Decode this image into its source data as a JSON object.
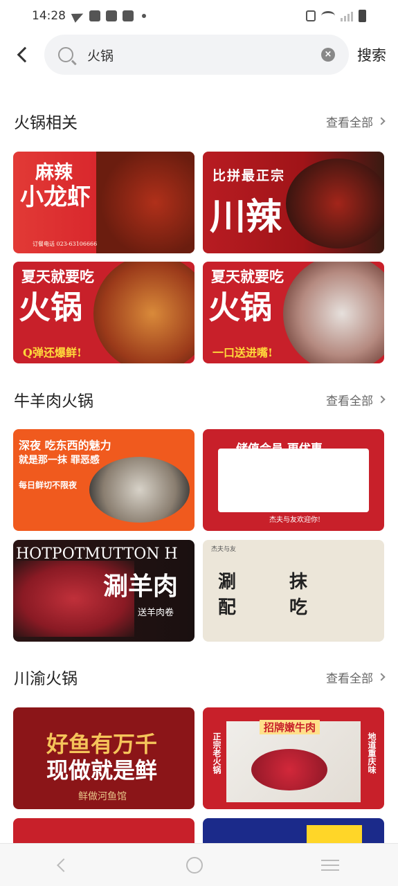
{
  "status": {
    "time": "14:28"
  },
  "search": {
    "query": "火锅",
    "button": "搜索"
  },
  "sections": [
    {
      "title": "火锅相关",
      "view_all": "查看全部",
      "cards": [
        {
          "t1": "麻辣",
          "t2": "小龙虾",
          "t3": "订餐电话 023-63106666"
        },
        {
          "t1": "比拼最正宗",
          "t2": "川辣",
          "t3": ""
        },
        {
          "t1": "夏天就要吃",
          "t2": "火锅",
          "t3": "Q弹还爆鲜!"
        },
        {
          "t1": "夏天就要吃",
          "t2": "火锅",
          "t3": "一口送进嘴!"
        }
      ]
    },
    {
      "title": "牛羊肉火锅",
      "view_all": "查看全部",
      "cards": [
        {
          "t1": "深夜 吃东西的魅力",
          "t2": "就是那一抹 罪恶感",
          "t3": "每日鲜切不限夜"
        },
        {
          "t1": "储值会员 更优惠",
          "t2": "杰夫与友欢迎你!",
          "t3": ""
        },
        {
          "t1": "HOTPOTMUTTON H",
          "t2": "涮羊肉",
          "t3": "送羊肉卷"
        },
        {
          "t1": "杰夫与友",
          "t2": "涮 抹 配 吃",
          "t3": ""
        }
      ]
    },
    {
      "title": "川渝火锅",
      "view_all": "查看全部",
      "cards": [
        {
          "t1": "好鱼有万千",
          "t2": "现做就是鲜",
          "t3": "鲜做河鱼馆"
        },
        {
          "t1": "招牌嫩牛肉",
          "t2": "正宗老火锅",
          "t3": "地道重庆味"
        }
      ]
    }
  ],
  "colors": {
    "accent": "#c8202a",
    "dark": "#8b1518"
  }
}
